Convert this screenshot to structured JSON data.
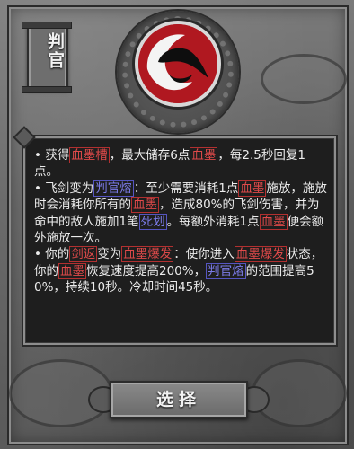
{
  "title": "判官",
  "select_button": "选择",
  "emblem_icon": "blood-swirl-icon",
  "description": {
    "line1": {
      "a": "• 获得",
      "t1": "血墨槽",
      "b": "，最大储存6点",
      "t2": "血墨",
      "c": "，每2.5秒回复1点。"
    },
    "line2": {
      "a": "• 飞剑变为",
      "t1": "判官熔",
      "b": "：至少需要消耗1点",
      "t2": "血墨",
      "c": "施放，施放时会消耗你所有的",
      "t3": "血墨",
      "d": "，造成80%的飞剑伤害，并为命中的敌人施加1笔",
      "t4": "死划",
      "e": "。每额外消耗1点",
      "t5": "血墨",
      "f": "便会额外施放一次。"
    },
    "line3": {
      "a": "• 你的",
      "t1": "剑返",
      "b": "变为",
      "t2": "血墨爆发",
      "c": "：使你进入",
      "t3": "血墨爆发",
      "d": "状态，你的",
      "t4": "血墨",
      "e": "恢复速度提高200%，",
      "t5": "判官熔",
      "f": "的范围提高50%，持续10秒。冷却时间45秒。"
    }
  },
  "colors": {
    "keyword_red": "#e04a4a",
    "keyword_blue": "#7b7be8",
    "emblem": "#b01820"
  }
}
